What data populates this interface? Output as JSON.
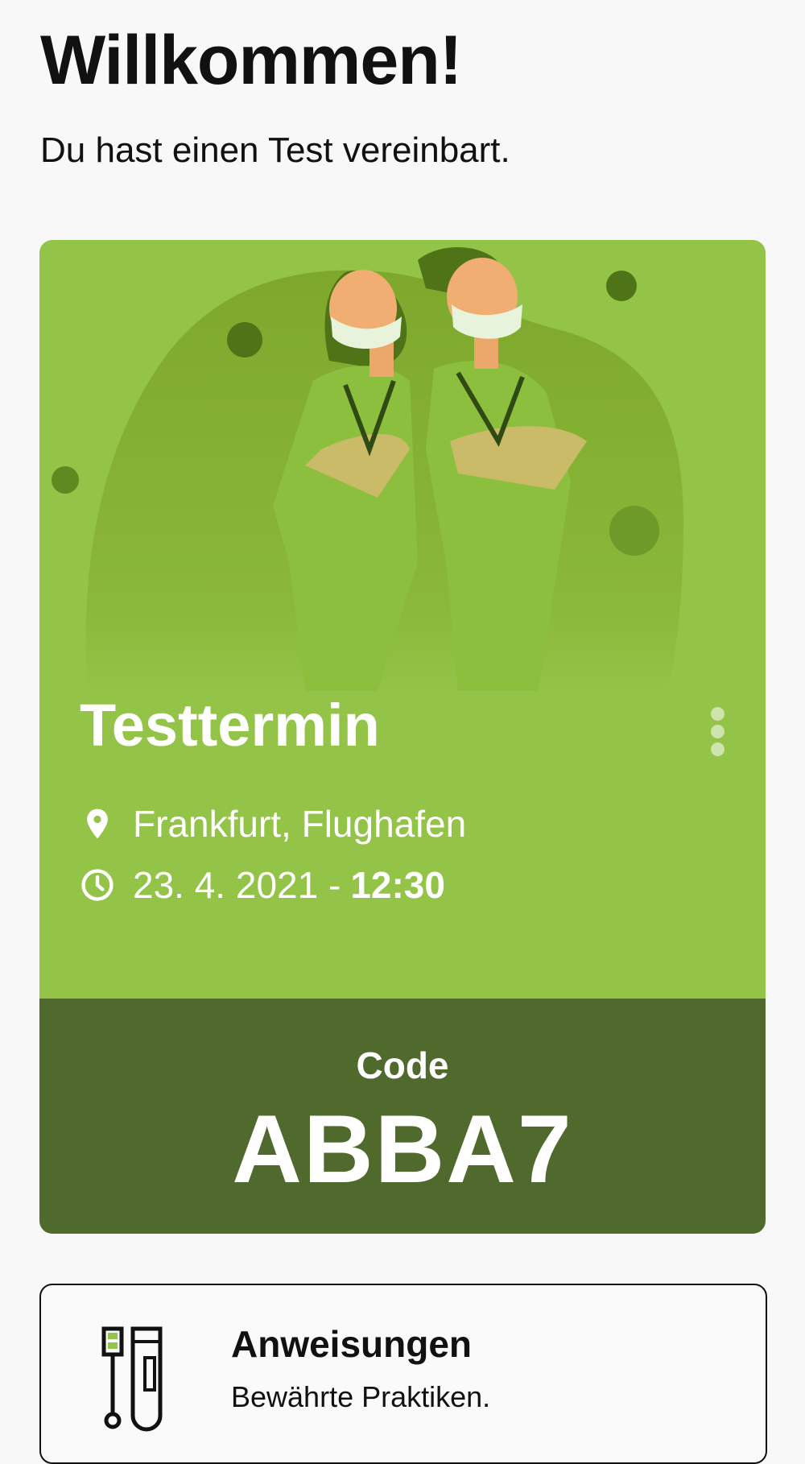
{
  "header": {
    "title": "Willkommen!",
    "subtitle": "Du hast einen Test vereinbart."
  },
  "appointment": {
    "title": "Testtermin",
    "location": "Frankfurt, Flughafen",
    "date": "23. 4. 2021 -",
    "time": "12:30",
    "code_label": "Code",
    "code": "ABBA7",
    "colors": {
      "card": "#93c347",
      "code_panel": "#506a2d",
      "blob": "#7ea82b"
    },
    "icons": [
      "location-pin-icon",
      "clock-icon",
      "more-vertical-icon"
    ]
  },
  "instructions": {
    "title": "Anweisungen",
    "subtitle": "Bewährte Praktiken.",
    "icon": "test-tube-icon"
  }
}
